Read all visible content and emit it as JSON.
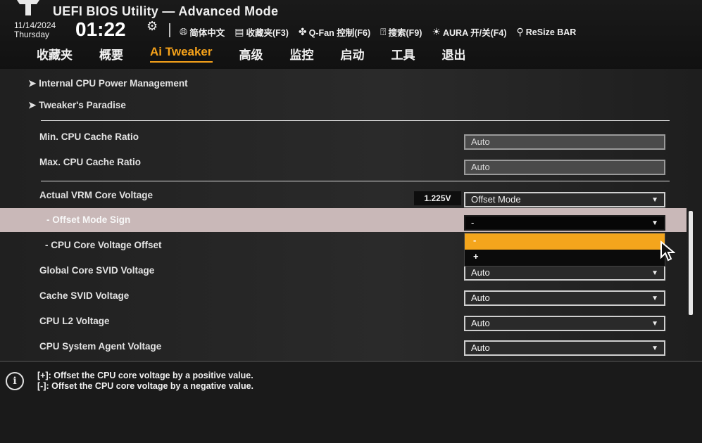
{
  "header": {
    "title": "UEFI BIOS Utility — Advanced Mode",
    "date": "11/14/2024",
    "weekday": "Thursday",
    "time": "01:22",
    "toolbar": [
      {
        "icon": "globe-icon",
        "label": "简体中文"
      },
      {
        "icon": "favorites-icon",
        "label": "收藏夹(F3)"
      },
      {
        "icon": "fan-icon",
        "label": "Q-Fan 控制(F6)"
      },
      {
        "icon": "help-icon",
        "label": "搜索(F9)"
      },
      {
        "icon": "aura-icon",
        "label": "AURA 开/关(F4)"
      },
      {
        "icon": "resize-bar-icon",
        "label": "ReSize BAR"
      }
    ]
  },
  "tabs": [
    "收藏夹",
    "概要",
    "Ai Tweaker",
    "高级",
    "监控",
    "启动",
    "工具",
    "退出"
  ],
  "active_tab": "Ai Tweaker",
  "menu": {
    "nav": [
      {
        "label": "Internal CPU Power Management"
      },
      {
        "label": "Tweaker's Paradise"
      }
    ],
    "rows": [
      {
        "label": "Min. CPU Cache Ratio",
        "value": "Auto"
      },
      {
        "label": "Max. CPU Cache Ratio",
        "value": "Auto"
      },
      {
        "label": "Actual VRM Core Voltage",
        "reading": "1.225V",
        "value": "Offset Mode"
      },
      {
        "label": "- Offset Mode Sign",
        "value": "-"
      },
      {
        "label": "- CPU Core Voltage Offset",
        "value": ""
      },
      {
        "label": "Global Core SVID Voltage",
        "value": "Auto"
      },
      {
        "label": "Cache SVID Voltage",
        "value": "Auto"
      },
      {
        "label": "CPU L2 Voltage",
        "value": "Auto"
      },
      {
        "label": "CPU System Agent Voltage",
        "value": "Auto"
      }
    ],
    "dropdown_options": [
      "-",
      "+"
    ]
  },
  "help": {
    "line1": "[+]: Offset the CPU core voltage by a positive value.",
    "line2": "[-]: Offset the CPU core voltage by a negative value."
  },
  "colors": {
    "accent": "#f4a51c",
    "highlight_row": "#c9b8b8"
  }
}
